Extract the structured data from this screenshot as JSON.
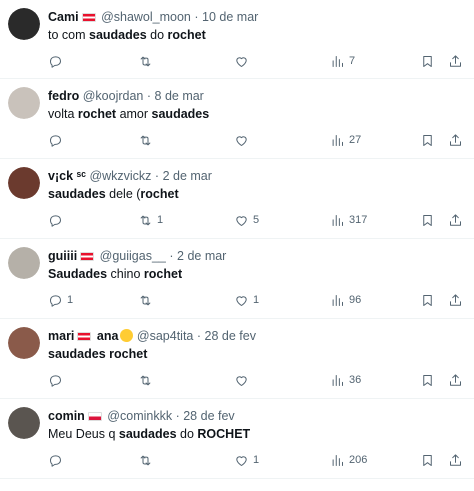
{
  "tweets": [
    {
      "name": "Cami",
      "flag": "at",
      "emoji": false,
      "name_suffix": "",
      "handle": "@shawol_moon",
      "sep": "·",
      "date": "10 de mar",
      "text": [
        {
          "t": "to com ",
          "b": false
        },
        {
          "t": "saudades",
          "b": true
        },
        {
          "t": " do ",
          "b": false
        },
        {
          "t": "rochet",
          "b": true
        }
      ],
      "replies": "",
      "retweets": "",
      "likes": "",
      "views": "7",
      "avatar_color": "#2a2a2a"
    },
    {
      "name": "fedro",
      "flag": "",
      "emoji": false,
      "name_suffix": "",
      "handle": "@koojrdan",
      "sep": "·",
      "date": "8 de mar",
      "text": [
        {
          "t": "volta ",
          "b": false
        },
        {
          "t": "rochet",
          "b": true
        },
        {
          "t": " amor ",
          "b": false
        },
        {
          "t": "saudades",
          "b": true
        }
      ],
      "replies": "",
      "retweets": "",
      "likes": "",
      "views": "27",
      "avatar_color": "#c9c2bb"
    },
    {
      "name": "v¡ck ˢᶜ",
      "flag": "",
      "emoji": false,
      "name_suffix": "",
      "handle": "@wkzvickz",
      "sep": "·",
      "date": "2 de mar",
      "text": [
        {
          "t": "saudades",
          "b": true
        },
        {
          "t": " dele (",
          "b": false
        },
        {
          "t": "rochet",
          "b": true
        }
      ],
      "replies": "",
      "retweets": "1",
      "likes": "5",
      "views": "317",
      "avatar_color": "#6b3a2e"
    },
    {
      "name": "guiiii",
      "flag": "at",
      "emoji": false,
      "name_suffix": "",
      "handle": "@guiigas__",
      "sep": "·",
      "date": "2 de mar",
      "text": [
        {
          "t": "Saudades",
          "b": true
        },
        {
          "t": " chino ",
          "b": false
        },
        {
          "t": "rochet",
          "b": true
        }
      ],
      "replies": "1",
      "retweets": "",
      "likes": "1",
      "views": "96",
      "avatar_color": "#b5b0a8"
    },
    {
      "name": "mari",
      "flag": "at",
      "emoji": true,
      "name_suffix": " ana",
      "handle": "@sap4tita",
      "sep": "·",
      "date": "28 de fev",
      "text": [
        {
          "t": "saudades",
          "b": true
        },
        {
          "t": " ",
          "b": false
        },
        {
          "t": "rochet",
          "b": true
        }
      ],
      "replies": "",
      "retweets": "",
      "likes": "",
      "views": "36",
      "avatar_color": "#8a5a4a"
    },
    {
      "name": "comin",
      "flag": "pl",
      "emoji": false,
      "name_suffix": "",
      "handle": "@cominkkk",
      "sep": "·",
      "date": "28 de fev",
      "text": [
        {
          "t": "Meu Deus q ",
          "b": false
        },
        {
          "t": "saudades",
          "b": true
        },
        {
          "t": " do ",
          "b": false
        },
        {
          "t": "ROCHET",
          "b": true
        }
      ],
      "replies": "",
      "retweets": "",
      "likes": "1",
      "views": "206",
      "avatar_color": "#5a5550"
    }
  ],
  "icons": {
    "reply": "reply-icon",
    "retweet": "retweet-icon",
    "like": "heart-icon",
    "views": "views-icon",
    "bookmark": "bookmark-icon",
    "share": "share-icon"
  },
  "colors": {
    "text": "#0f1419",
    "secondary": "#536471",
    "divider": "#eff3f4"
  }
}
